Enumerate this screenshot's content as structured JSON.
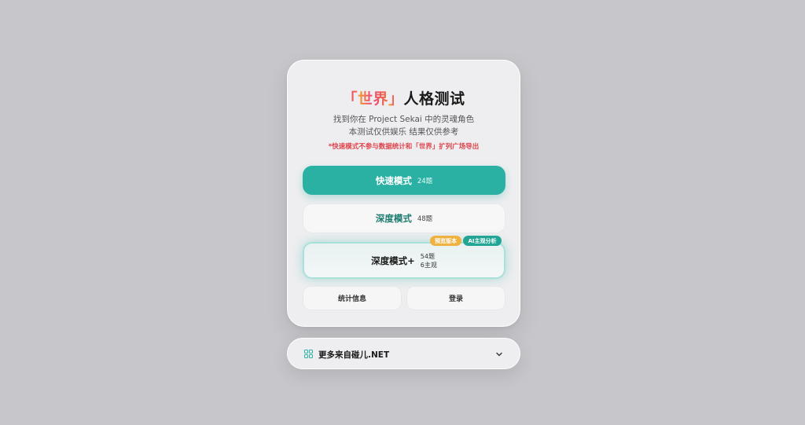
{
  "card": {
    "title_prefix": "「",
    "title_accent": "世界",
    "title_suffix": "」人格测试",
    "subtitle_line1": "找到你在 Project Sekai 中的灵魂角色",
    "subtitle_line2": "本测试仅供娱乐 结果仅供参考",
    "notice": "*快速模式不参与数据统计和「世界」扩列广场导出",
    "modes": [
      {
        "name": "快速模式",
        "count": "24题"
      },
      {
        "name": "深度模式",
        "count": "48题"
      },
      {
        "name": "深度模式+",
        "count": "54题",
        "count_extra": "6主观",
        "badges": [
          {
            "label": "预览版本"
          },
          {
            "label": "AI主观分析"
          }
        ]
      }
    ],
    "buttons": {
      "stats": "统计信息",
      "login": "登录"
    }
  },
  "more": {
    "label": "更多来自碰儿.NET",
    "icon": "grid-icon",
    "toggle_icon": "chevron-down-icon"
  },
  "colors": {
    "background": "#c7c6cb",
    "accent_teal": "#2bb1a3",
    "notice_red": "#e0434c",
    "badge_orange": "#f0b23f",
    "badge_teal": "#23a595"
  }
}
